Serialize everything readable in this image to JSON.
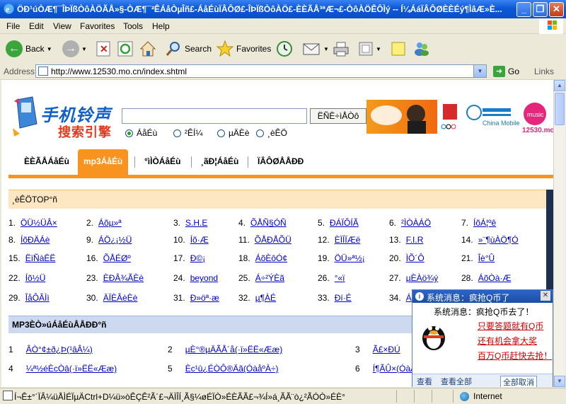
{
  "window": {
    "title": "ÖÐ¹úÒÆ¶¯ÎÞÏßÒôÀÖÃÅ»§-ÒÆ¶¯²ÊÁåÒµÎñ£-ÁåÉùÏÂÔØ£-ÎÞÏßÒôÀÖ£-ÈÈÃÅ³ªÆ¬£-ÒôÀÖÊÔÌý -- Í¼ÁáÏÂÔØÈÈÉý¶ÌâÆ»È..."
  },
  "menu": [
    "File",
    "Edit",
    "View",
    "Favorites",
    "Tools",
    "Help"
  ],
  "toolbar": {
    "back": "Back",
    "search": "Search",
    "favorites": "Favorites"
  },
  "address": {
    "label": "Address",
    "url": "http://www.12530.mo.cn/index.shtml",
    "go": "Go",
    "links": "Links"
  },
  "page": {
    "logo_line1": "手机铃声",
    "logo_line2": "搜索引擎",
    "search_button": "ËÑË÷ìÅÒô",
    "radios": [
      "ÁåÉù",
      "²ÊÍ¼",
      "µÄÈè",
      "¸èÊÖ"
    ],
    "banner_brand": "China Mobile",
    "banner_site": "12530.mo.cn",
    "nav": [
      "ÈÈÃÅÁåÉù",
      "mp3ÁåÉù",
      "°ìÌÒÁåÉù",
      "¸ãÐ¦ÁåÉù",
      "ÏÂÔØÅÅÐÐ"
    ],
    "section1_title": "¸èÊÖTOP°ñ",
    "section2_title": "MP3ÈÒ»úÁåÉùÅÅÐÐ°ñ"
  },
  "rankings": [
    [
      {
        "n": "1.",
        "t": "ÖÜ½ÜÂ×"
      },
      {
        "n": "2.",
        "t": "Áõµ»ª"
      },
      {
        "n": "3.",
        "t": "S.H.E"
      },
      {
        "n": "4.",
        "t": "ÕÅÑ§ÓÑ"
      },
      {
        "n": "5.",
        "t": "ÐÁÏÔÍÃ"
      },
      {
        "n": "6.",
        "t": "²ÌÒÀÁÖ"
      },
      {
        "n": "7.",
        "t": "ÍõÁ¦ºê"
      }
    ],
    [
      {
        "n": "8.",
        "t": "ÍõÐÄÁè"
      },
      {
        "n": "9.",
        "t": "ÁÖ¿¡½Ü"
      },
      {
        "n": "10.",
        "t": "Íõ·Æ"
      },
      {
        "n": "11.",
        "t": "ÕÅÐÅÕÜ"
      },
      {
        "n": "12.",
        "t": "ÈÏÍÏÆë"
      },
      {
        "n": "13.",
        "t": "F.I.R"
      },
      {
        "n": "14.",
        "t": "»¨¶ùÀÖ¶Ó"
      }
    ],
    [
      {
        "n": "15.",
        "t": "ËïÑàËË"
      },
      {
        "n": "16.",
        "t": "ÕÅÉØº"
      },
      {
        "n": "17.",
        "t": "Ð©¡"
      },
      {
        "n": "18.",
        "t": "ÁõÈôÓ¢"
      },
      {
        "n": "19.",
        "t": "ÖÜ»ª½¡"
      },
      {
        "n": "20.",
        "t": "ÌÕ´Ô"
      },
      {
        "n": "21.",
        "t": "Îè°Û"
      }
    ],
    [
      {
        "n": "22.",
        "t": "Íõ½Ü"
      },
      {
        "n": "23.",
        "t": "ÈÐÂ¾ÃÈè"
      },
      {
        "n": "24.",
        "t": "beyond"
      },
      {
        "n": "25.",
        "t": "Á÷²ÝÈã"
      },
      {
        "n": "26.",
        "t": "°«ï"
      },
      {
        "n": "27.",
        "t": "µÈÀö¾ý"
      },
      {
        "n": "28.",
        "t": "ÁõÒà·Æ"
      }
    ],
    [
      {
        "n": "29.",
        "t": "ÎåÔÂÌì"
      },
      {
        "n": "30.",
        "t": "ÄÏÈÂèÈè"
      },
      {
        "n": "31.",
        "t": "Ð»öª·æ"
      },
      {
        "n": "32.",
        "t": "µ¶ÀÉ"
      },
      {
        "n": "33.",
        "t": "Ðí·É"
      },
      {
        "n": "34.",
        "t": "ÁÖ"
      }
    ]
  ],
  "mp3list": [
    [
      {
        "n": "1",
        "t": "ÂÒ°¢±ð¿Þ(¹âÂ¼)"
      },
      {
        "n": "2",
        "t": "µÈ°®µÄÃÅ´å(·ï»ËË«Ææ)"
      },
      {
        "n": "3",
        "t": "Ã£×ÐÚ"
      }
    ],
    [
      {
        "n": "4",
        "t": "¼ª½éÈcÒâ(·ï»ËË«Ææ)"
      },
      {
        "n": "5",
        "t": "Èc¹û¿ÉÒÔ®Äã(ÓàåºÀ÷)"
      },
      {
        "n": "6",
        "t": "Í¶ÃÛ×(ÓàÅ"
      }
    ]
  ],
  "popup": {
    "title": "系统消息：疯抢Q币了",
    "message": "系统消息：疯抢Q币去了！",
    "links": [
      "只要答题就有Q币",
      "还有机会拿大奖",
      "百万Q币赶快去抢！"
    ],
    "footer": [
      "查看",
      "查看全部",
      "全部取消"
    ]
  },
  "status": {
    "text": "Í¬Ê±°´ÏÂ¼üÅÌÉÏµÄCtrl+D¼ü»òÊÇÊ²Ã´£¬ÄÌÎÍ¸Ã§¼øÉÏÒ»ÉÈÃÃ£¬¾Í»á¸ÃÃ¨ò¿²ÃÓÒ»ÉÈ°",
    "zone": "Internet"
  }
}
